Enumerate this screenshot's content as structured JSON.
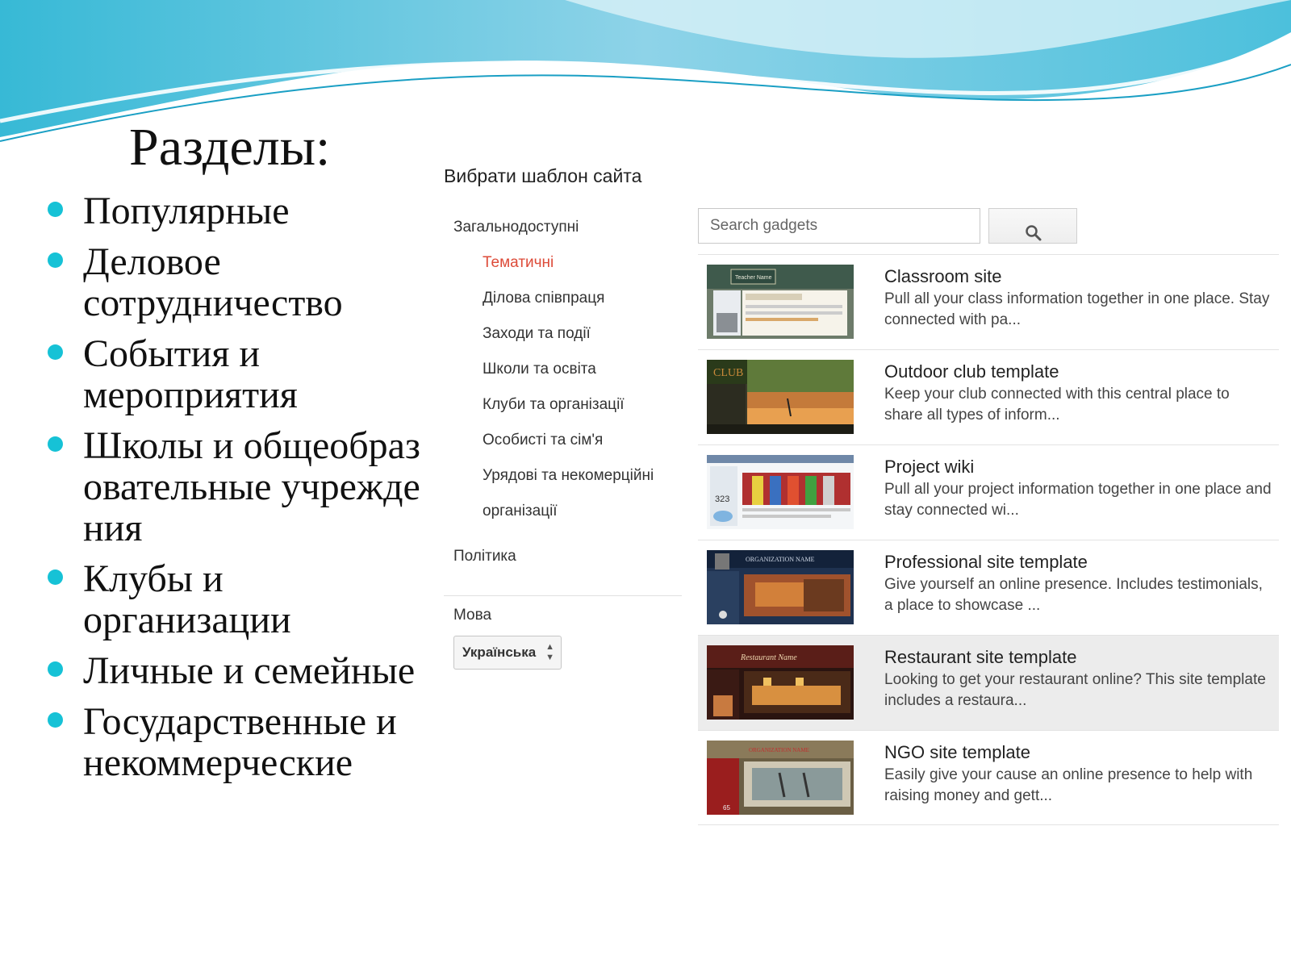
{
  "slide": {
    "title": "Разделы:",
    "bullets": [
      "Популярные",
      "Деловое сотрудничество",
      "События и мероприятия",
      "Школы и общеобразовательные учреждения",
      "Клубы и организации",
      "Личные и семейные",
      "Государственные и некоммерческие"
    ]
  },
  "panel": {
    "heading": "Вибрати шаблон сайта",
    "nav": {
      "section_public": "Загальнодоступні",
      "items": [
        "Тематичні",
        "Ділова співпраця",
        "Заходи та події",
        "Школи та освіта",
        "Клуби та організації",
        "Особисті та сім'я",
        "Урядові та некомерційні",
        "організації"
      ],
      "active_item": "Тематичні",
      "section_policy": "Політика",
      "language_label": "Мова",
      "language_value": "Українська"
    },
    "search": {
      "placeholder": "Search gadgets",
      "button_icon": "search-icon"
    },
    "templates": [
      {
        "name": "Classroom site",
        "description": "Pull all your class information together in one place. Stay connected with pa..."
      },
      {
        "name": "Outdoor club template",
        "description": "Keep your club connected with this central place to share all types of inform..."
      },
      {
        "name": "Project wiki",
        "description": "Pull all your project information together in one place and stay connected wi..."
      },
      {
        "name": "Professional site template",
        "description": "Give yourself an online presence. Includes testimonials, a place to showcase ..."
      },
      {
        "name": "Restaurant site template",
        "description": "Looking to get your restaurant online? This site template includes a restaura..."
      },
      {
        "name": "NGO site template",
        "description": "Easily give your cause an online presence to help with raising money and gett..."
      }
    ],
    "thumb_texts": {
      "classroom": "Teacher Name",
      "outdoor": "CLUB",
      "project_count": "323",
      "professional": "ORGANIZATION NAME",
      "restaurant": "Restaurant Name",
      "ngo": "ORGANIZATION NAME",
      "ngo_number": "65"
    }
  },
  "colors": {
    "bullet": "#16c2d6",
    "active_nav": "#dd4b39",
    "wave_dark": "#2fb5d3",
    "wave_light": "#bfe8f2"
  }
}
